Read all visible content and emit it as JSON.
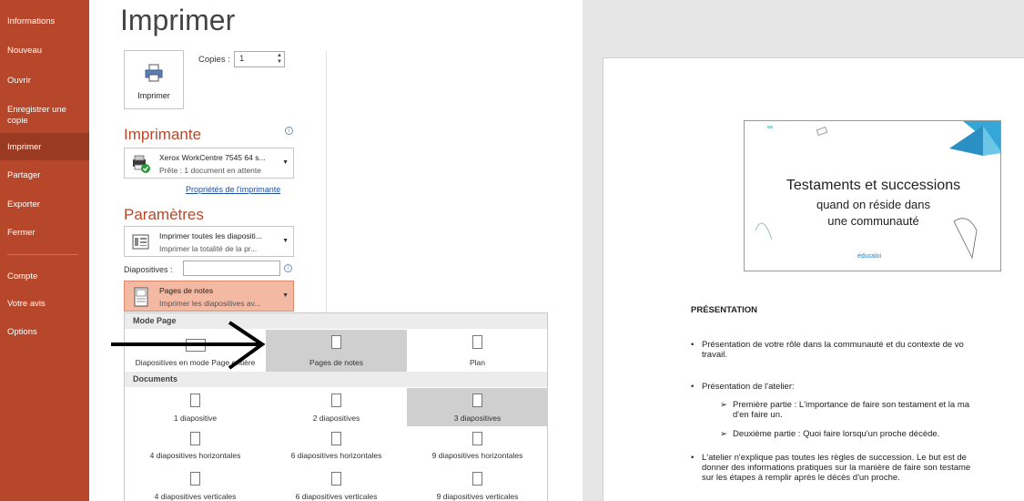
{
  "sidebar": {
    "items": [
      {
        "label": "Informations"
      },
      {
        "label": "Nouveau"
      },
      {
        "label": "Ouvrir"
      },
      {
        "label": "Enregistrer une copie"
      },
      {
        "label": "Imprimer"
      },
      {
        "label": "Partager"
      },
      {
        "label": "Exporter"
      },
      {
        "label": "Fermer"
      },
      {
        "label": "Compte"
      },
      {
        "label": "Votre avis"
      },
      {
        "label": "Options"
      }
    ],
    "active": "Imprimer"
  },
  "main": {
    "title": "Imprimer",
    "print_button": "Imprimer",
    "copies_label": "Copies :",
    "copies_value": "1"
  },
  "printer": {
    "heading": "Imprimante",
    "name": "Xerox WorkCentre 7545 64 s...",
    "status": "Prête : 1 document en attente",
    "properties_link": "Propriétés de l'imprimante"
  },
  "settings": {
    "heading": "Paramètres",
    "range_line1": "Imprimer toutes les diapositi...",
    "range_line2": "Imprimer la totalité de la pr...",
    "slides_label": "Diapositives :",
    "slides_value": "",
    "layout_line1": "Pages de notes",
    "layout_line2": "Imprimer les diapositives av..."
  },
  "layout_popup": {
    "mode_header": "Mode Page",
    "mode_items": [
      "Diapositives en mode Page entière",
      "Pages de notes",
      "Plan"
    ],
    "mode_selected": 1,
    "docs_header": "Documents",
    "doc_items": [
      "1 diapositive",
      "2 diapositives",
      "3 diapositives",
      "4 diapositives horizontales",
      "6 diapositives horizontales",
      "9 diapositives horizontales",
      "4 diapositives verticales",
      "6 diapositives verticales",
      "9 diapositives verticales"
    ],
    "doc_selected": 2
  },
  "preview": {
    "slide_title": "Testaments et successions",
    "slide_subtitle1": "quand on réside dans",
    "slide_subtitle2": "une communauté",
    "slide_logo": "éducaloi",
    "notes_heading": "PRÉSENTATION",
    "notes_lines": [
      "Présentation de votre rôle dans la communauté et du contexte de vo",
      "travail.",
      "Présentation de l'atelier:",
      "Première partie : L'importance de faire son testament et la ma",
      "d'en faire un.",
      "Deuxième partie : Quoi faire lorsqu'un proche décède.",
      "L'atelier n'explique pas toutes les règles de succession. Le but est de",
      "donner des informations pratiques sur la manière de faire son testame",
      "sur les étapes à remplir après le décès d'un proche."
    ]
  },
  "colors": {
    "sidebar": "#b7472a",
    "accent": "#b7472a",
    "selected_layout": "#f3b9a3"
  }
}
